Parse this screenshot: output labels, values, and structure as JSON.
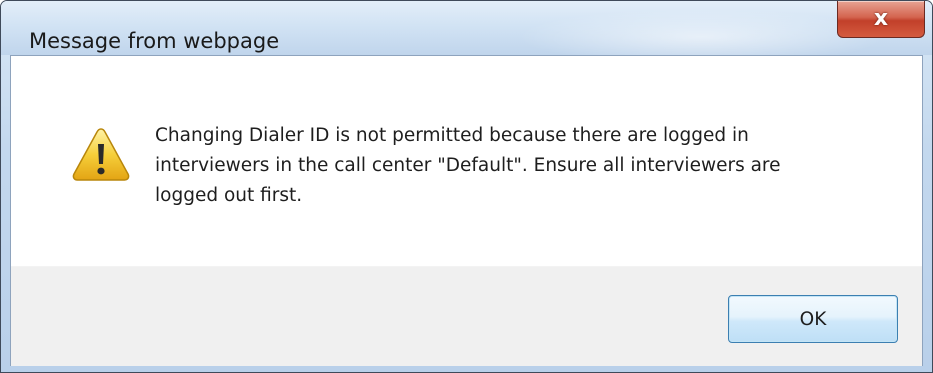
{
  "window": {
    "title": "Message from webpage"
  },
  "titlebar": {
    "close_glyph": "x",
    "close_icon": "close-icon"
  },
  "dialog": {
    "icon": "warning-icon",
    "message": "Changing Dialer ID is not permitted because there are logged in\ninterviewers in the call center \"Default\". Ensure all interviewers are\nlogged out first."
  },
  "buttons": {
    "ok_label": "OK"
  },
  "colors": {
    "close_button": "#c2402a",
    "warning_yellow": "#f6cf3a",
    "titlebar": "#d2e3f4",
    "footer": "#f0f0f0"
  }
}
